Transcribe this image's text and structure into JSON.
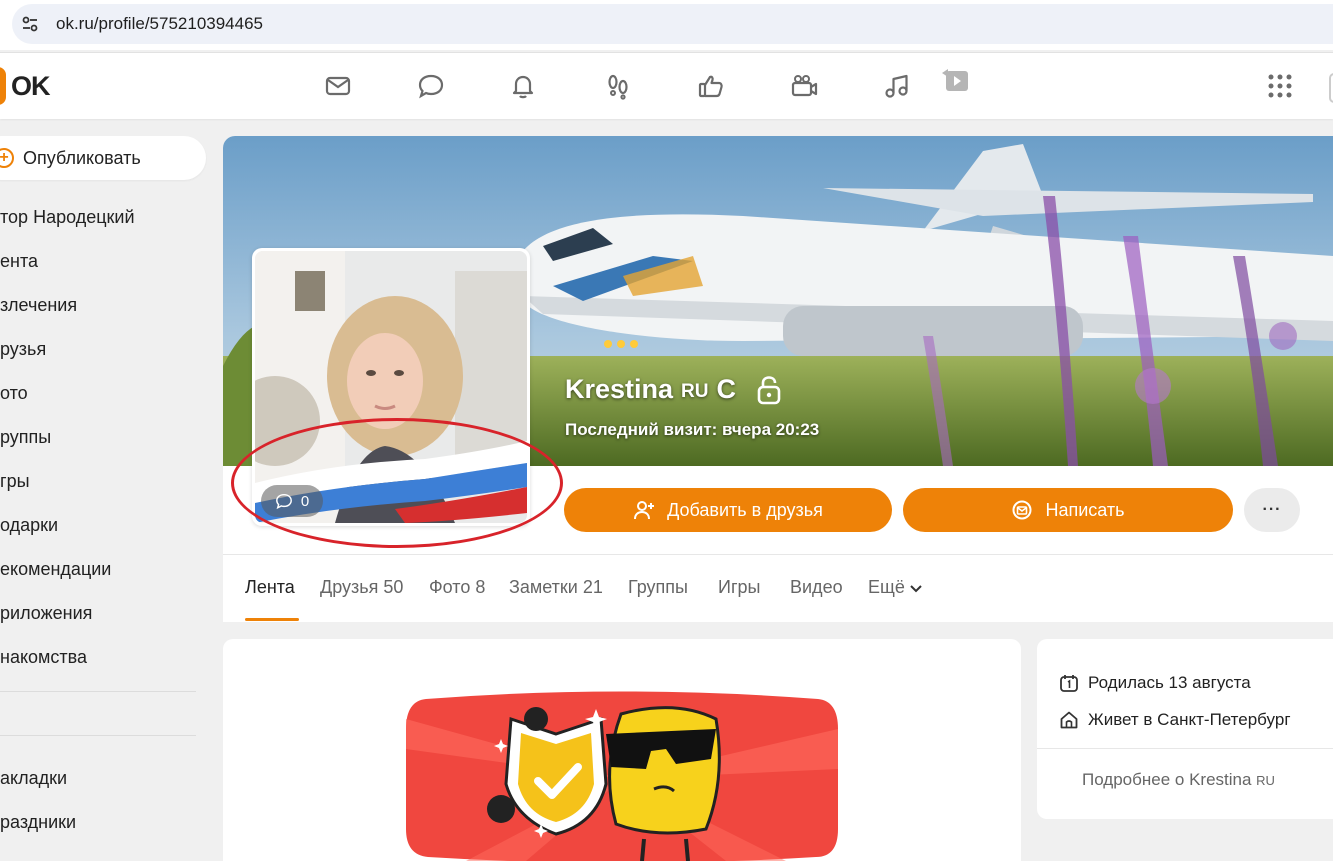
{
  "browser": {
    "url": "ok.ru/profile/575210394465"
  },
  "header": {
    "logo_text": "OK",
    "brand_color": "#ee8208",
    "icons": [
      "mail-icon",
      "chat-icon",
      "bell-icon",
      "guests-footprints-icon",
      "like-icon",
      "video-camera-icon",
      "music-note-icon",
      "video-play-icon",
      "apps-grid-icon"
    ]
  },
  "sidebar": {
    "publish_label": "Опубликовать",
    "user_name": "тор Народецкий",
    "items": [
      {
        "label": "ента"
      },
      {
        "label": "злечения"
      },
      {
        "label": "рузья"
      },
      {
        "label": "ото"
      },
      {
        "label": "руппы"
      },
      {
        "label": "гры"
      },
      {
        "label": "одарки"
      },
      {
        "label": "екомендации"
      },
      {
        "label": "риложения"
      },
      {
        "label": "накомства"
      }
    ],
    "items_bottom": [
      {
        "label": "акладки"
      },
      {
        "label": "раздники"
      }
    ]
  },
  "profile": {
    "name": "Krestina",
    "name_badge": "RU",
    "name_suffix": "C",
    "last_visit": "Последний визит: вчера 20:23",
    "avatar_comments_count": "0",
    "add_friend_label": "Добавить в друзья",
    "write_label": "Написать",
    "more_label": "···"
  },
  "tabs": [
    {
      "label": "Лента",
      "active": true
    },
    {
      "label": "Друзья 50"
    },
    {
      "label": "Фото 8"
    },
    {
      "label": "Заметки 21"
    },
    {
      "label": "Группы"
    },
    {
      "label": "Игры"
    },
    {
      "label": "Видео"
    },
    {
      "label": "Ещё"
    }
  ],
  "info": {
    "birthday": "Родилась 13 августа",
    "city": "Живет в Санкт-Петербург",
    "more_prefix": "Подробнее о Krestina",
    "more_badge": "RU"
  }
}
